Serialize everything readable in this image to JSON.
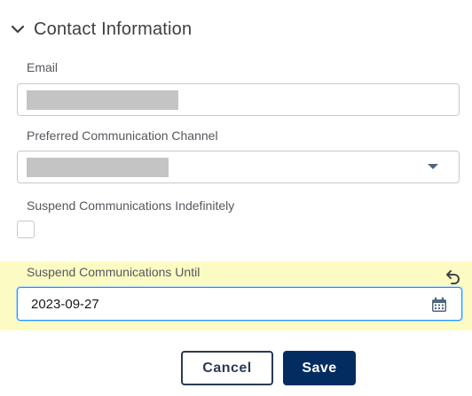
{
  "section": {
    "title": "Contact Information",
    "expanded": true
  },
  "fields": {
    "email": {
      "label": "Email",
      "value_redacted": true
    },
    "channel": {
      "label": "Preferred Communication Channel",
      "value_redacted": true
    },
    "suspend_indefinitely": {
      "label": "Suspend Communications Indefinitely",
      "checked": false
    },
    "suspend_until": {
      "label": "Suspend Communications Until",
      "value": "2023-09-27",
      "highlighted": true
    }
  },
  "buttons": {
    "cancel": "Cancel",
    "save": "Save"
  },
  "icons": {
    "section_toggle": "chevron-down-icon",
    "dropdown": "caret-down-icon",
    "undo": "undo-icon",
    "calendar": "calendar-icon"
  },
  "colors": {
    "highlight": "#fdfbc4",
    "save_button": "#032d60",
    "focus_border": "#1b96ff",
    "redaction": "#c4c4c4"
  }
}
